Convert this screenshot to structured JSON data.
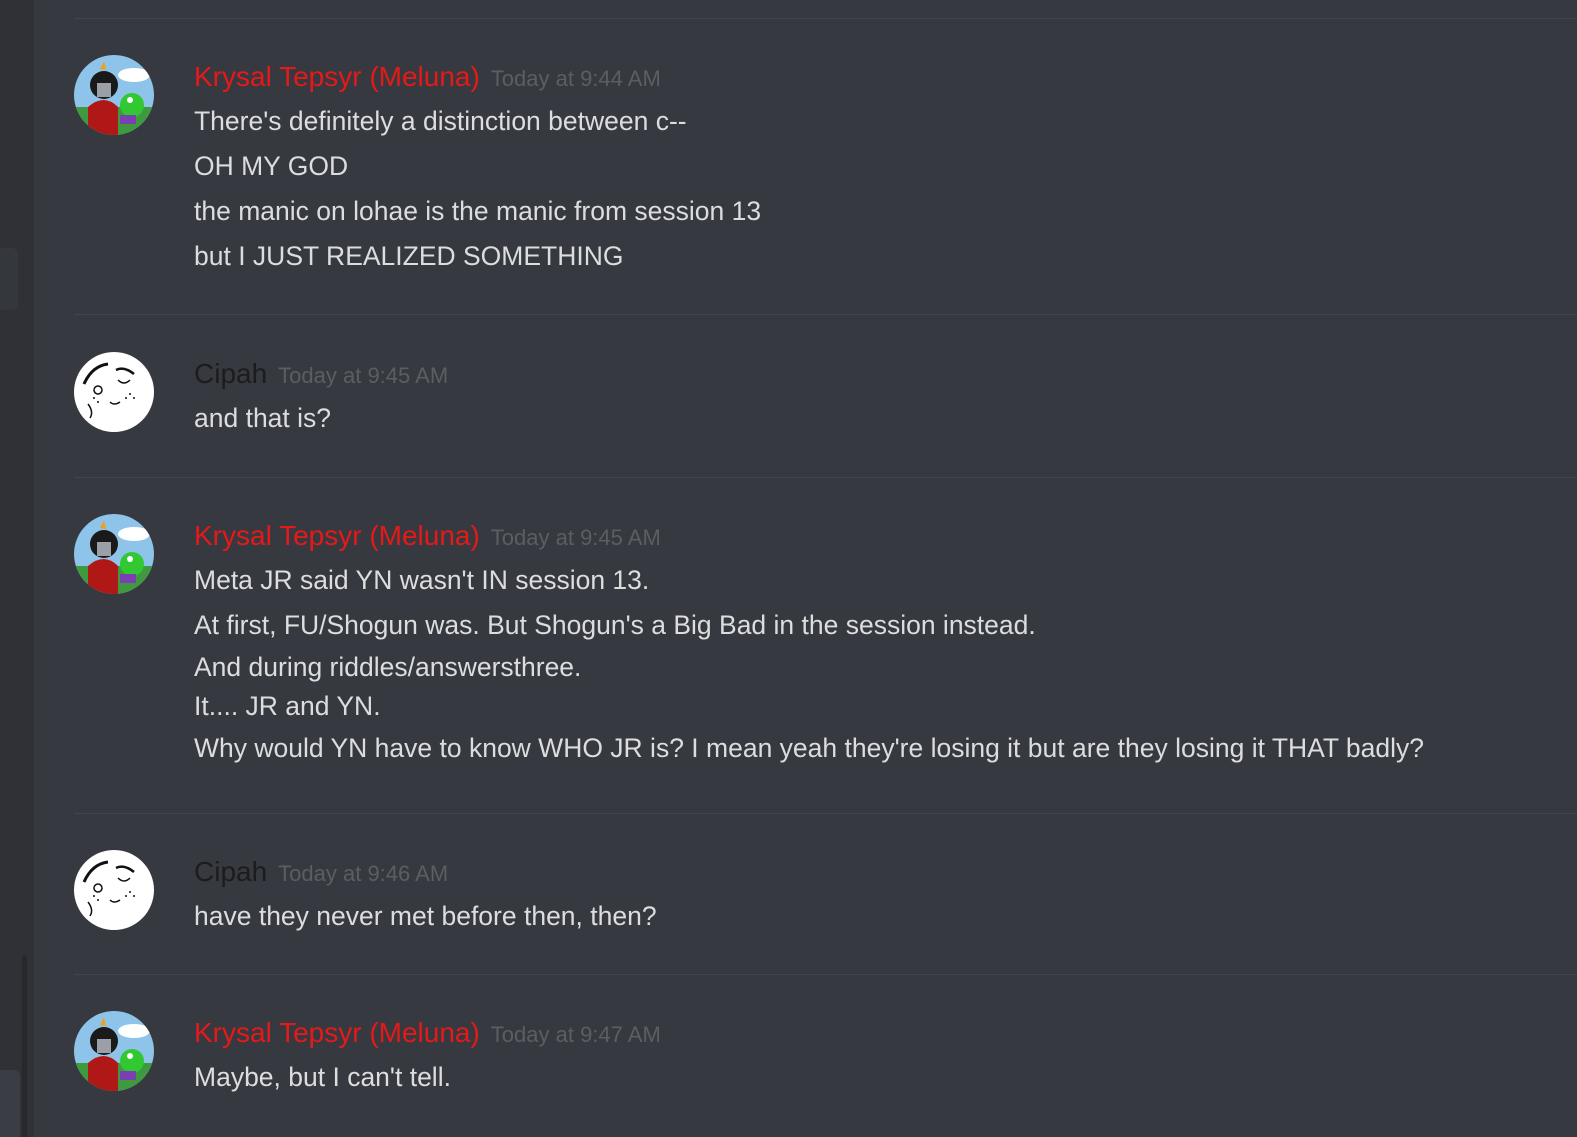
{
  "colors": {
    "background": "#36393f",
    "username_krysal": "#e61919",
    "username_cipah": "#1c1c1c",
    "timestamp": "#5b5e63",
    "message_text": "#dcddde"
  },
  "messages": [
    {
      "author": "Krysal Tepsyr (Meluna)",
      "timestamp": "Today at 9:44 AM",
      "avatar_icon": "troll-girl-avatar-icon",
      "lines": [
        "There's definitely a distinction between c--",
        "OH MY GOD",
        "the manic on lohae is the manic from session 13",
        "but I JUST REALIZED SOMETHING"
      ]
    },
    {
      "author": "Cipah",
      "timestamp": "Today at 9:45 AM",
      "avatar_icon": "sketch-face-avatar-icon",
      "lines": [
        "and that is?"
      ]
    },
    {
      "author": "Krysal Tepsyr (Meluna)",
      "timestamp": "Today at 9:45 AM",
      "avatar_icon": "troll-girl-avatar-icon",
      "lines": [
        "Meta JR said YN wasn't IN session 13.",
        "At first, FU/Shogun was. But Shogun's a Big Bad in the session instead.",
        "And during riddles/answersthree.",
        "It.... JR and YN.",
        "Why would YN have to know WHO JR is? I mean yeah they're losing it but are they losing it THAT badly?"
      ]
    },
    {
      "author": "Cipah",
      "timestamp": "Today at 9:46 AM",
      "avatar_icon": "sketch-face-avatar-icon",
      "lines": [
        "have they never met before then, then?"
      ]
    },
    {
      "author": "Krysal Tepsyr (Meluna)",
      "timestamp": "Today at 9:47 AM",
      "avatar_icon": "troll-girl-avatar-icon",
      "lines": [
        "Maybe, but I can't tell."
      ]
    }
  ]
}
